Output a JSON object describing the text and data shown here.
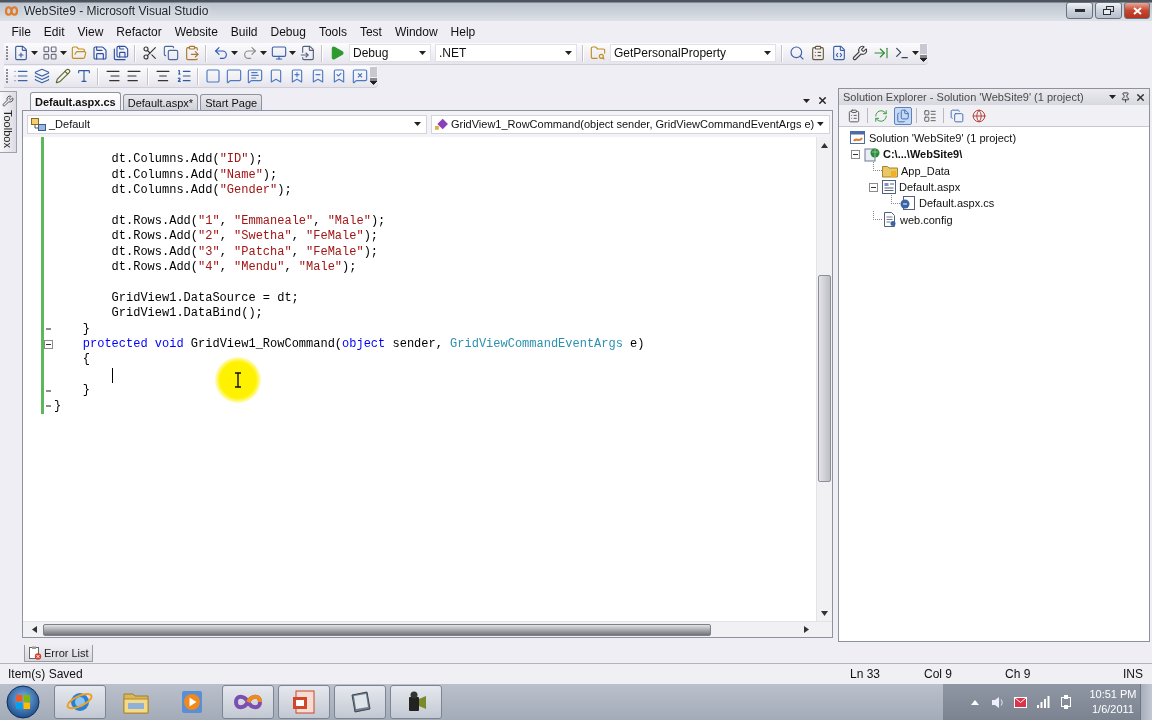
{
  "window": {
    "title": "WebSite9 - Microsoft Visual Studio"
  },
  "menu": [
    "File",
    "Edit",
    "View",
    "Refactor",
    "Website",
    "Build",
    "Debug",
    "Tools",
    "Test",
    "Window",
    "Help"
  ],
  "toolbar": {
    "configuration": "Debug",
    "platform": ".NET",
    "find": "GetPersonalProperty"
  },
  "toolbox": {
    "label": "Toolbox"
  },
  "document_tabs": [
    {
      "label": "Default.aspx.cs",
      "selected": true
    },
    {
      "label": "Default.aspx*",
      "selected": false
    },
    {
      "label": "Start Page",
      "selected": false
    }
  ],
  "navigation": {
    "class": "_Default",
    "member": "GridView1_RowCommand(object sender, GridViewCommandEventArgs e)"
  },
  "code": [
    {
      "kind": "group",
      "children": [
        {
          "kind": "group",
          "children": [
            {
              "kind": "code",
              "caret": false
            },
            {
              "kind": "code",
              "caret": false,
              "tokens": [
                {
                  "kind": "plain",
                  "text": "dt.Columns.Add("
                },
                {
                  "kind": "string",
                  "text": "\"ID\""
                },
                {
                  "kind": "plain",
                  "text": ");"
                }
              ]
            },
            {
              "kind": "code",
              "caret": false,
              "tokens": [
                {
                  "kind": "plain",
                  "text": "dt.Columns.Add("
                },
                {
                  "kind": "string",
                  "text": "\"Name\""
                },
                {
                  "kind": "plain",
                  "text": ");"
                }
              ]
            },
            {
              "kind": "code",
              "caret": false,
              "tokens": [
                {
                  "kind": "plain",
                  "text": "dt.Columns.Add("
                },
                {
                  "kind": "string",
                  "text": "\"Gender\""
                },
                {
                  "kind": "plain",
                  "text": ");"
                }
              ]
            },
            {
              "kind": "code",
              "caret": false
            },
            {
              "kind": "code",
              "caret": false,
              "tokens": [
                {
                  "kind": "plain",
                  "text": "dt.Rows.Add("
                },
                {
                  "kind": "string",
                  "text": "\"1\""
                },
                {
                  "kind": "plain",
                  "text": ", "
                },
                {
                  "kind": "string",
                  "text": "\"Emmaneale\""
                },
                {
                  "kind": "plain",
                  "text": ", "
                },
                {
                  "kind": "string",
                  "text": "\"Male\""
                },
                {
                  "kind": "plain",
                  "text": ");"
                }
              ]
            },
            {
              "kind": "code",
              "caret": false,
              "tokens": [
                {
                  "kind": "plain",
                  "text": "dt.Rows.Add("
                },
                {
                  "kind": "string",
                  "text": "\"2\""
                },
                {
                  "kind": "plain",
                  "text": ", "
                },
                {
                  "kind": "string",
                  "text": "\"Swetha\""
                },
                {
                  "kind": "plain",
                  "text": ", "
                },
                {
                  "kind": "string",
                  "text": "\"FeMale\""
                },
                {
                  "kind": "plain",
                  "text": ");"
                }
              ]
            },
            {
              "kind": "code",
              "caret": false,
              "tokens": [
                {
                  "kind": "plain",
                  "text": "dt.Rows.Add("
                },
                {
                  "kind": "string",
                  "text": "\"3\""
                },
                {
                  "kind": "plain",
                  "text": ", "
                },
                {
                  "kind": "string",
                  "text": "\"Patcha\""
                },
                {
                  "kind": "plain",
                  "text": ", "
                },
                {
                  "kind": "string",
                  "text": "\"FeMale\""
                },
                {
                  "kind": "plain",
                  "text": ");"
                }
              ]
            },
            {
              "kind": "code",
              "caret": false,
              "tokens": [
                {
                  "kind": "plain",
                  "text": "dt.Rows.Add("
                },
                {
                  "kind": "string",
                  "text": "\"4\""
                },
                {
                  "kind": "plain",
                  "text": ", "
                },
                {
                  "kind": "string",
                  "text": "\"Mendu\""
                },
                {
                  "kind": "plain",
                  "text": ", "
                },
                {
                  "kind": "string",
                  "text": "\"Male\""
                },
                {
                  "kind": "plain",
                  "text": ");"
                }
              ]
            },
            {
              "kind": "code",
              "caret": false
            },
            {
              "kind": "code",
              "caret": false,
              "tokens": [
                {
                  "kind": "plain",
                  "text": "GridView1.DataSource = dt;"
                }
              ]
            },
            {
              "kind": "code",
              "caret": false,
              "tokens": [
                {
                  "kind": "plain",
                  "text": "GridView1.DataBind();"
                }
              ]
            }
          ]
        },
        {
          "kind": "block_end",
          "caret": false,
          "tokens": [
            {
              "kind": "plain",
              "text": "}"
            }
          ]
        },
        {
          "kind": "block_start",
          "caret": false,
          "expanded": true,
          "tokens": [
            {
              "kind": "keyword",
              "text": "protected "
            },
            {
              "kind": "keyword",
              "text": "void"
            },
            {
              "kind": "plain",
              "text": " GridView1_RowCommand("
            },
            {
              "kind": "keyword",
              "text": "object"
            },
            {
              "kind": "plain",
              "text": " sender, "
            },
            {
              "kind": "type",
              "text": "GridViewCommandEventArgs"
            },
            {
              "kind": "plain",
              "text": " e)"
            }
          ]
        },
        {
          "kind": "code",
          "caret": false,
          "tokens": [
            {
              "kind": "plain",
              "text": "{"
            }
          ]
        },
        {
          "kind": "group",
          "children": [
            {
              "kind": "code",
              "caret": true
            }
          ]
        },
        {
          "kind": "block_end",
          "caret": false,
          "tokens": [
            {
              "kind": "plain",
              "text": "}"
            }
          ]
        }
      ]
    },
    {
      "kind": "block_end",
      "caret": false,
      "tokens": [
        {
          "kind": "plain",
          "text": "}"
        }
      ]
    }
  ],
  "tool_tabs": [
    {
      "label": "Error List"
    }
  ],
  "solution_explorer": {
    "title": "Solution Explorer - Solution 'WebSite9' (1 project)",
    "toolbar": [
      {
        "kind": "properties",
        "on": false
      },
      {
        "kind": "refresh",
        "on": false
      },
      {
        "kind": "nest",
        "on": true
      },
      {
        "kind": "view",
        "on": false
      },
      {
        "kind": "copy",
        "on": false
      },
      {
        "kind": "config",
        "on": false
      }
    ],
    "tree": [
      {
        "kind": "solution",
        "label": "Solution 'WebSite9' (1 project)",
        "children": [
          {
            "kind": "website",
            "label": "C:\\...\\WebSite9\\",
            "startup": true,
            "expanded": true,
            "children": [
              {
                "kind": "folder",
                "label": "App_Data"
              },
              {
                "kind": "page",
                "label": "Default.aspx",
                "expanded": true,
                "children": [
                  {
                    "kind": "codefile",
                    "label": "Default.aspx.cs"
                  }
                ]
              },
              {
                "kind": "config",
                "label": "web.config"
              }
            ]
          }
        ]
      }
    ]
  },
  "status_bar": {
    "message": "Item(s) Saved",
    "line": "Ln 33",
    "column": "Col 9",
    "character": "Ch 9",
    "mode": "INS"
  },
  "taskbar": {
    "buttons": [
      {
        "kind": "browser",
        "running": true
      },
      {
        "kind": "folder",
        "running": false
      },
      {
        "kind": "media",
        "running": false
      },
      {
        "kind": "ide",
        "running": true
      },
      {
        "kind": "presentation",
        "running": true
      },
      {
        "kind": "notepad",
        "running": true
      },
      {
        "kind": "camera",
        "running": true
      }
    ],
    "clock": {
      "time": "10:51 PM",
      "date": "1/6/2011"
    }
  }
}
